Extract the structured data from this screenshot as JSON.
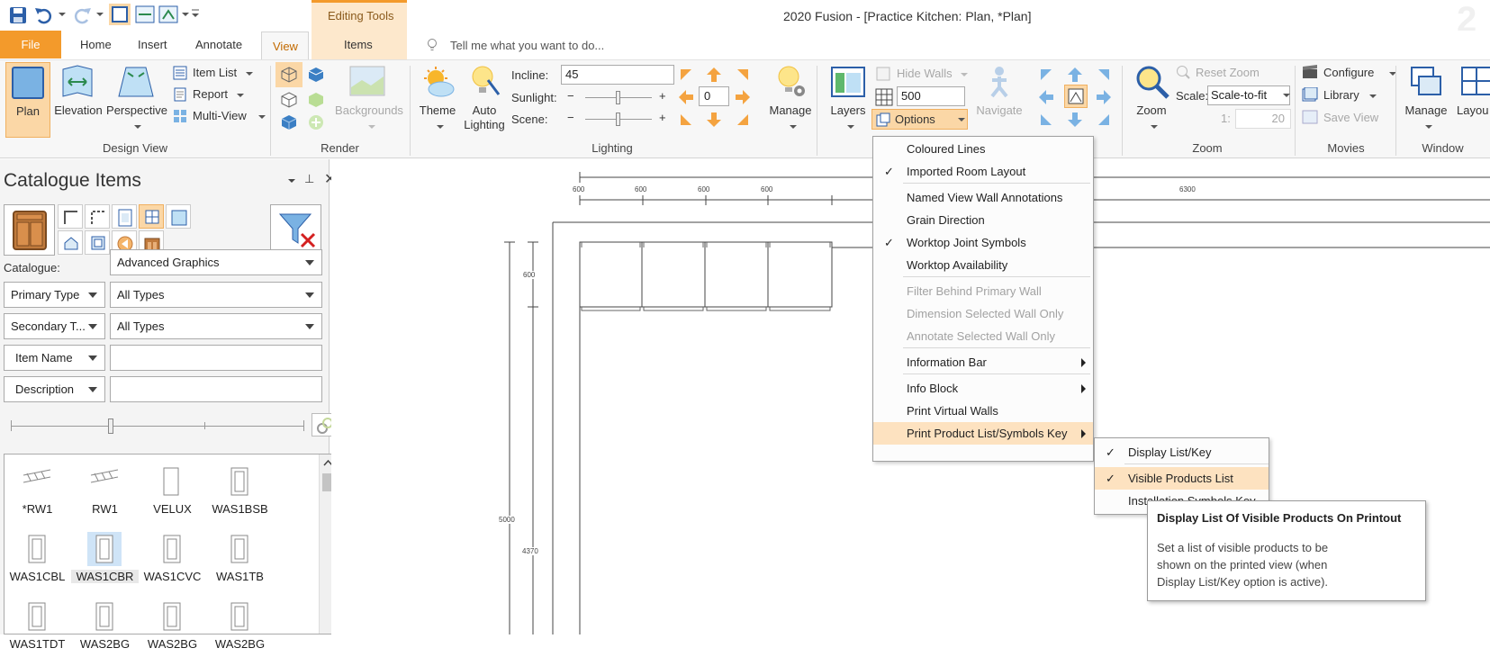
{
  "app": {
    "window_title": "2020 Fusion - [Practice Kitchen: Plan, *Plan]",
    "contextual_tab_group": "Editing Tools"
  },
  "tabs": [
    {
      "label": "File"
    },
    {
      "label": "Home"
    },
    {
      "label": "Insert"
    },
    {
      "label": "Annotate"
    },
    {
      "label": "View"
    },
    {
      "label": "Items"
    }
  ],
  "tell_me": "Tell me what you want to do...",
  "ribbon": {
    "design_view": {
      "label": "Design View",
      "plan": "Plan",
      "elevation": "Elevation",
      "perspective": "Perspective",
      "item_list": "Item List",
      "report": "Report",
      "multi_view": "Multi-View"
    },
    "render": {
      "label": "Render",
      "backgrounds": "Backgrounds"
    },
    "lighting": {
      "label": "Lighting",
      "theme": "Theme",
      "auto_lighting_1": "Auto",
      "auto_lighting_2": "Lighting",
      "incline_label": "Incline:",
      "incline_value": "45",
      "sunlight_label": "Sunlight:",
      "scene_label": "Scene:",
      "minus": "−",
      "plus": "+",
      "rotation_value": "0"
    },
    "manage": {
      "label": "Manage"
    },
    "layers": {
      "label": "Layers",
      "hide_walls": "Hide Walls",
      "grid_value": "500",
      "options": "Options",
      "navigate": "Navigate"
    },
    "zoom": {
      "label": "Zoom",
      "zoom_btn": "Zoom",
      "reset_zoom": "Reset Zoom",
      "scale_label": "Scale:",
      "scale_value": "Scale-to-fit",
      "ratio_prefix": "1:",
      "ratio_value": "20"
    },
    "movies": {
      "label": "Movies",
      "configure": "Configure",
      "library": "Library",
      "save_view": "Save View"
    },
    "window": {
      "label": "Window",
      "manage": "Manage",
      "layout": "Layou"
    }
  },
  "catalogue_panel": {
    "title": "Catalogue Items",
    "catalogue_label": "Catalogue:",
    "catalogue_value": "Advanced Graphics",
    "primary_type_label": "Primary Type",
    "primary_type_value": "All Types",
    "secondary_type_label": "Secondary T...",
    "secondary_type_value": "All Types",
    "item_name_label": "Item Name",
    "item_name_value": "",
    "description_label": "Description",
    "description_value": "",
    "items": [
      {
        "label": "*RW1"
      },
      {
        "label": "RW1"
      },
      {
        "label": "VELUX"
      },
      {
        "label": "WAS1BSB"
      },
      {
        "label": "WAS1CBL"
      },
      {
        "label": "WAS1CBR",
        "selected": true
      },
      {
        "label": "WAS1CVC"
      },
      {
        "label": "WAS1TB"
      },
      {
        "label": "WAS1TDT"
      },
      {
        "label": "WAS2BG"
      },
      {
        "label": "WAS2BG"
      },
      {
        "label": "WAS2BG"
      }
    ]
  },
  "plan": {
    "dims": [
      "600",
      "600",
      "600",
      "600",
      "6300",
      "600",
      "5000",
      "4370"
    ]
  },
  "options_menu": {
    "items": [
      {
        "label": "Coloured Lines",
        "checked": false,
        "disabled": false
      },
      {
        "label": "Imported Room Layout",
        "checked": true,
        "disabled": false
      },
      {
        "label": "Named View Wall Annotations",
        "checked": false,
        "disabled": false
      },
      {
        "label": "Grain Direction",
        "checked": false,
        "disabled": false
      },
      {
        "label": "Worktop Joint Symbols",
        "checked": true,
        "disabled": false
      },
      {
        "label": "Worktop Availability",
        "checked": false,
        "disabled": false
      },
      {
        "label": "Filter Behind Primary Wall",
        "checked": false,
        "disabled": true
      },
      {
        "label": "Dimension Selected Wall Only",
        "checked": false,
        "disabled": true
      },
      {
        "label": "Annotate Selected Wall Only",
        "checked": false,
        "disabled": true
      },
      {
        "label": "Information Bar",
        "submenu": true
      },
      {
        "label": "Info Block",
        "submenu": true
      },
      {
        "label": "Print Virtual Walls"
      },
      {
        "label": "Print Product List/Symbols Key",
        "submenu": true,
        "highlighted": true
      }
    ],
    "check_glyph": "✓"
  },
  "submenu": {
    "items": [
      {
        "label": "Display List/Key",
        "checked": true
      },
      {
        "label": "Visible Products List",
        "checked": true,
        "highlighted": true
      },
      {
        "label": "Installation Symbols Key",
        "partial": "Installation Symbols Key"
      }
    ]
  },
  "tooltip": {
    "title": "Display List Of Visible Products On Printout",
    "body": "Set a list of visible products to be shown on the printed view (when Display List/Key option is active)."
  },
  "colors": {
    "accent_orange": "#f39a2b",
    "ribbon_highlight": "#fbd7a6",
    "menu_highlight": "#fde2c0",
    "selection_blue": "#cfe4f7",
    "icon_blue": "#3b7fc4"
  }
}
